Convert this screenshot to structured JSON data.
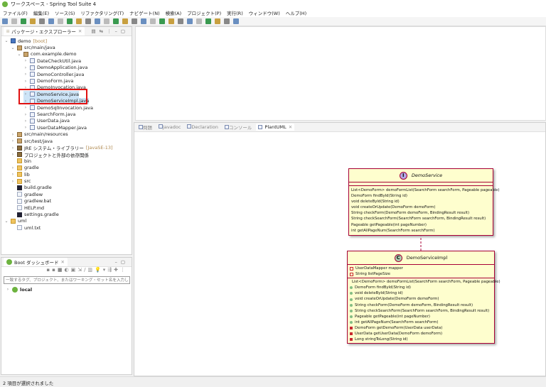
{
  "window": {
    "title": "ワークスペース - Spring Tool Suite 4"
  },
  "menu": [
    "ファイル(F)",
    "編集(E)",
    "ソース(S)",
    "リファクタリング(T)",
    "ナビゲート(N)",
    "検索(A)",
    "プロジェクト(P)",
    "実行(R)",
    "ウィンドウ(W)",
    "ヘルプ(H)"
  ],
  "package_explorer": {
    "title": "パッケージ・エクスプローラー",
    "items": [
      {
        "label": "demo",
        "decoration": "[boot]",
        "icon": "project-icon",
        "level": 0,
        "twisty": "open"
      },
      {
        "label": "src/main/java",
        "icon": "source-folder-icon",
        "level": 1,
        "twisty": "open"
      },
      {
        "label": "com.example.demo",
        "icon": "package-icon",
        "level": 2,
        "twisty": "open"
      },
      {
        "label": "DateCheckUtil.java",
        "icon": "java-file-icon",
        "level": 3,
        "twisty": "closed"
      },
      {
        "label": "DemoApplication.java",
        "icon": "java-file-icon",
        "level": 3,
        "twisty": "closed"
      },
      {
        "label": "DemoController.java",
        "icon": "java-file-icon",
        "level": 3,
        "twisty": "closed"
      },
      {
        "label": "DemoForm.java",
        "icon": "java-file-icon",
        "level": 3,
        "twisty": "closed"
      },
      {
        "label": "DemoInvocation.java",
        "icon": "java-file-icon",
        "level": 3,
        "twisty": "closed"
      },
      {
        "label": "DemoService.java",
        "icon": "java-file-icon",
        "level": 3,
        "twisty": "closed",
        "selected": true
      },
      {
        "label": "DemoServiceImpl.java",
        "icon": "java-file-icon",
        "level": 3,
        "twisty": "closed",
        "selected": true
      },
      {
        "label": "DemoSqlInvocation.java",
        "icon": "java-file-icon",
        "level": 3,
        "twisty": "closed"
      },
      {
        "label": "SearchForm.java",
        "icon": "java-file-icon",
        "level": 3,
        "twisty": "closed"
      },
      {
        "label": "UserData.java",
        "icon": "java-file-icon",
        "level": 3,
        "twisty": "closed"
      },
      {
        "label": "UserDataMapper.java",
        "icon": "java-file-icon",
        "level": 3,
        "twisty": "closed"
      },
      {
        "label": "src/main/resources",
        "icon": "source-folder-icon",
        "level": 1,
        "twisty": "closed"
      },
      {
        "label": "src/test/java",
        "icon": "source-folder-icon",
        "level": 1,
        "twisty": "closed"
      },
      {
        "label": "JRE システム・ライブラリー",
        "decoration": "[JavaSE-13]",
        "icon": "library-icon",
        "level": 1,
        "twisty": "closed"
      },
      {
        "label": "プロジェクトと外部の依存関係",
        "icon": "library-icon",
        "level": 1,
        "twisty": "closed"
      },
      {
        "label": "bin",
        "icon": "folder-icon",
        "level": 1,
        "twisty": "none"
      },
      {
        "label": "gradle",
        "icon": "folder-icon",
        "level": 1,
        "twisty": "closed"
      },
      {
        "label": "lib",
        "icon": "folder-icon",
        "level": 1,
        "twisty": "closed"
      },
      {
        "label": "src",
        "icon": "folder-icon",
        "level": 1,
        "twisty": "closed"
      },
      {
        "label": "build.gradle",
        "icon": "gradle-icon",
        "level": 1,
        "twisty": "none"
      },
      {
        "label": "gradlew",
        "icon": "file-icon",
        "level": 1,
        "twisty": "none"
      },
      {
        "label": "gradlew.bat",
        "icon": "file-icon",
        "level": 1,
        "twisty": "none"
      },
      {
        "label": "HELP.md",
        "icon": "file-icon",
        "level": 1,
        "twisty": "none"
      },
      {
        "label": "settings.gradle",
        "icon": "gradle-icon",
        "level": 1,
        "twisty": "none"
      },
      {
        "label": "uml",
        "icon": "folder-icon",
        "level": 0,
        "twisty": "open"
      },
      {
        "label": "uml.txt",
        "icon": "file-icon",
        "level": 1,
        "twisty": "none"
      }
    ]
  },
  "boot_dashboard": {
    "title": "Boot ダッシュボード",
    "filter_placeholder": "一致するタグ、プロジェクト、またはワーキング・セット名を入力します (\" お",
    "items": [
      {
        "label": "local"
      }
    ]
  },
  "bottom_tabs": [
    {
      "label": "問題"
    },
    {
      "label": "Javadoc"
    },
    {
      "label": "Declaration"
    },
    {
      "label": "コンソール"
    },
    {
      "label": "PlantUML",
      "active": true
    }
  ],
  "diagram": {
    "interface": {
      "stereotype": "I",
      "name": "DemoService",
      "methods": [
        "List<DemoForm> demoFormList(SearchForm searchForm, Pageable pageable)",
        "DemoForm findById(String id)",
        "void deleteById(String id)",
        "void createOrUpdate(DemoForm demoForm)",
        "String checkForm(DemoForm demoForm, BindingResult result)",
        "String checkSearchForm(SearchForm searchForm, BindingResult result)",
        "Pageable getPageable(int pageNumber)",
        "int getAllPageNum(SearchForm searchForm)"
      ]
    },
    "class": {
      "stereotype": "C",
      "name": "DemoServiceImpl",
      "fields": [
        "UserDataMapper mapper",
        "String listPageSize"
      ],
      "public_methods": [
        "List<DemoForm> demoFormList(SearchForm searchForm, Pageable pageable)",
        "DemoForm findById(String id)",
        "void deleteById(String id)",
        "void createOrUpdate(DemoForm demoForm)",
        "String checkForm(DemoForm demoForm, BindingResult result)",
        "String checkSearchForm(SearchForm searchForm, BindingResult result)",
        "Pageable getPageable(int pageNumber)",
        "int getAllPageNum(SearchForm searchForm)"
      ],
      "private_methods": [
        "DemoForm getDemoForm(UserData userData)",
        "UserData getUserData(DemoForm demoForm)",
        "Long stringToLong(String id)"
      ]
    },
    "colors": {
      "box": "#fefece",
      "border": "#a80036",
      "interface_circle": "#b4a7e5",
      "class_circle": "#add1b2"
    }
  },
  "status": {
    "text": "2 項目が選択されました"
  }
}
